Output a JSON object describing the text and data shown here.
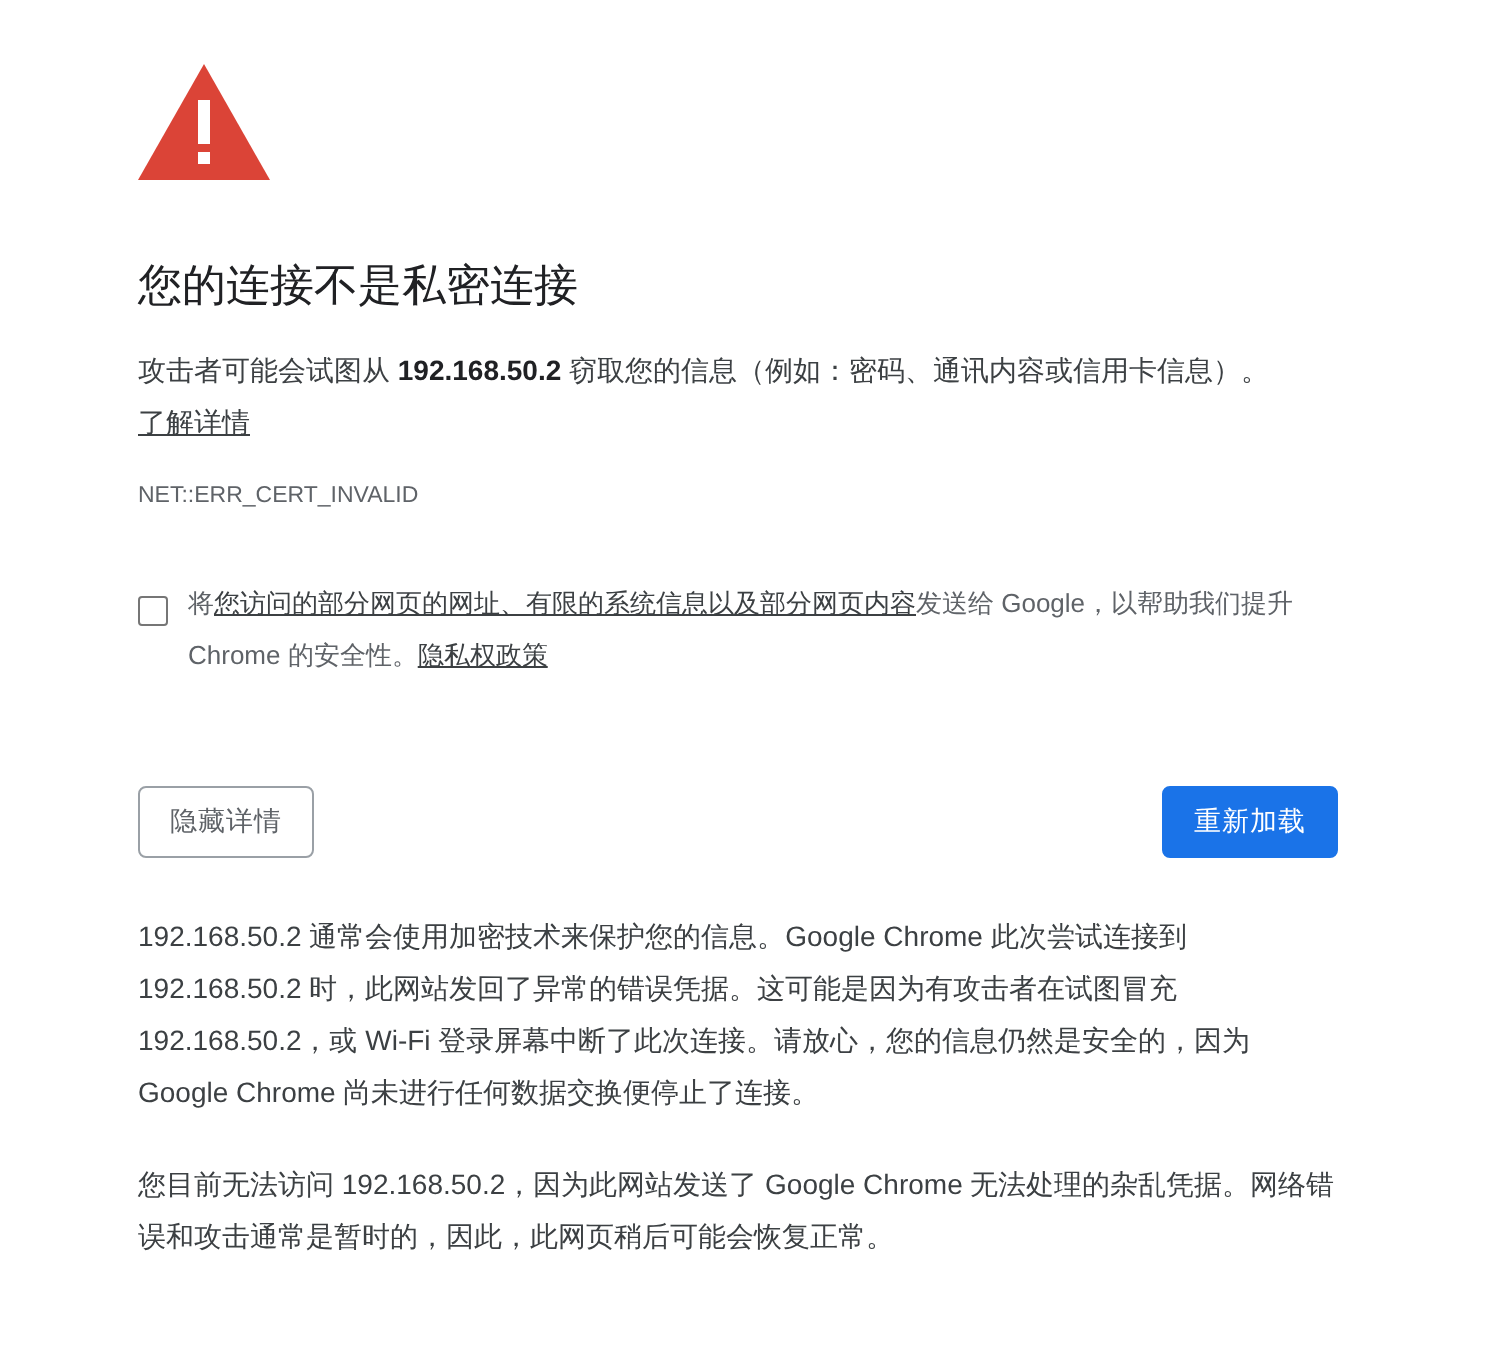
{
  "heading": "您的连接不是私密连接",
  "intro": {
    "text": "攻击者可能会试图从 **192.168.50.2** 窃取您的信息（例如：密码、通讯内容或信用卡信息）。",
    "link": "了解详情"
  },
  "error_code": "NET::ERR_CERT_INVALID",
  "report": {
    "checked": false,
    "before": "将",
    "link": "您访问的部分网页的网址、有限的系统信息以及部分网页内容",
    "after": "发送给 Google，以帮助我们提升 Chrome 的安全性。",
    "policy_link": "隐私权政策"
  },
  "buttons": {
    "details": "隐藏详情",
    "reload": "重新加载"
  },
  "details": [
    "192.168.50.2 通常会使用加密技术来保护您的信息。Google Chrome 此次尝试连接到 192.168.50.2 时，此网站发回了异常的错误凭据。这可能是因为有攻击者在试图冒充 192.168.50.2，或 Wi-Fi 登录屏幕中断了此次连接。请放心，您的信息仍然是安全的，因为 Google Chrome 尚未进行任何数据交换便停止了连接。",
    "您目前无法访问 192.168.50.2，因为此网站发送了 Google Chrome 无法处理的杂乱凭据。网络错误和攻击通常是暂时的，因此，此网页稍后可能会恢复正常。"
  ]
}
